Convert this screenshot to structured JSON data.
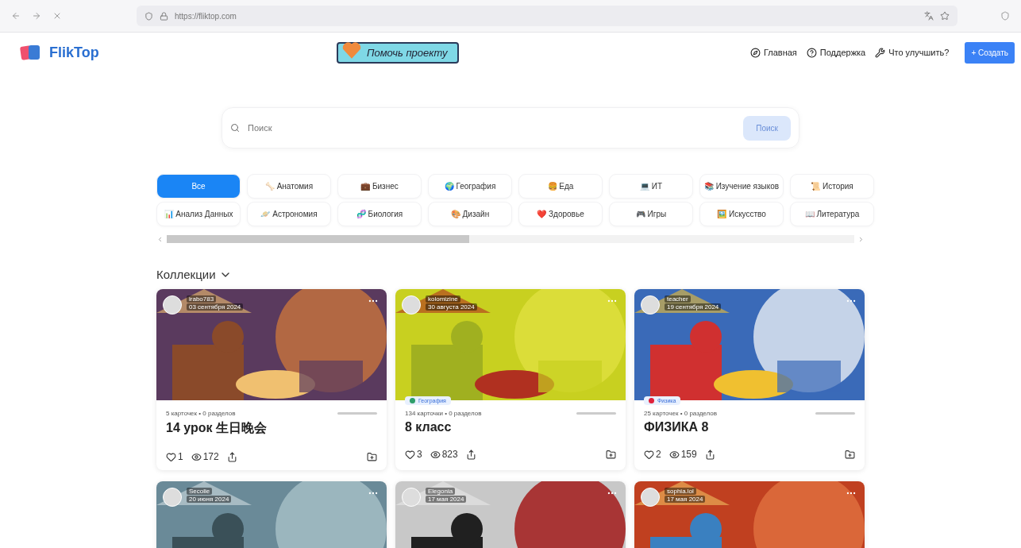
{
  "browser": {
    "url": "https://fliktop.com"
  },
  "header": {
    "logo": "FlikTop",
    "banner": "Помочь проекту",
    "nav": [
      "Главная",
      "Поддержка",
      "Что улучшить?"
    ],
    "create_button": "+ Создать"
  },
  "search": {
    "placeholder": "Поиск",
    "button": "Поиск"
  },
  "categories": [
    {
      "label": "Все",
      "selected": true
    },
    {
      "label": "Анатомия",
      "emoji": "🦴",
      "selected": false
    },
    {
      "label": "Бизнес",
      "emoji": "💼",
      "selected": false
    },
    {
      "label": "География",
      "emoji": "🌍",
      "selected": false
    },
    {
      "label": "Еда",
      "emoji": "🍔",
      "selected": false
    },
    {
      "label": "ИТ",
      "emoji": "💻",
      "selected": false
    },
    {
      "label": "Изучение языков",
      "emoji": "📚",
      "selected": false
    },
    {
      "label": "История",
      "emoji": "📜",
      "selected": false
    },
    {
      "label": "Анализ Данных",
      "emoji": "📊",
      "selected": false
    },
    {
      "label": "Астрономия",
      "emoji": "🪐",
      "selected": false
    },
    {
      "label": "Биология",
      "emoji": "🧬",
      "selected": false
    },
    {
      "label": "Дизайн",
      "emoji": "🎨",
      "selected": false
    },
    {
      "label": "Здоровье",
      "emoji": "❤️",
      "selected": false
    },
    {
      "label": "Игры",
      "emoji": "🎮",
      "selected": false
    },
    {
      "label": "Искусство",
      "emoji": "🖼️",
      "selected": false
    },
    {
      "label": "Литература",
      "emoji": "📖",
      "selected": false
    }
  ],
  "section_title": "Коллекции",
  "cards": [
    {
      "user": "irabo783",
      "date": "03 сентября 2024",
      "meta": "5 карточек • 0 разделов",
      "title": "14 урок 生日晚会",
      "likes": "1",
      "views": "172"
    },
    {
      "user": "kolomizine",
      "date": "30 августа 2024",
      "tag": "География",
      "color": "#2e9e6a",
      "meta": "134 карточки • 0 разделов",
      "title": "8 класс",
      "likes": "3",
      "views": "823"
    },
    {
      "user": "teacher",
      "date": "19 сентября 2024",
      "tag": "Физика",
      "color": "#e0203a",
      "meta": "25 карточек • 0 разделов",
      "title": "ФИЗИКА 8",
      "likes": "2",
      "views": "159"
    },
    {
      "user": "Secolie",
      "date": "20 июня 2024"
    },
    {
      "user": "Elegonia",
      "date": "17 мая 2024"
    },
    {
      "user": "sophia.lol",
      "date": "17 мая 2024"
    }
  ]
}
